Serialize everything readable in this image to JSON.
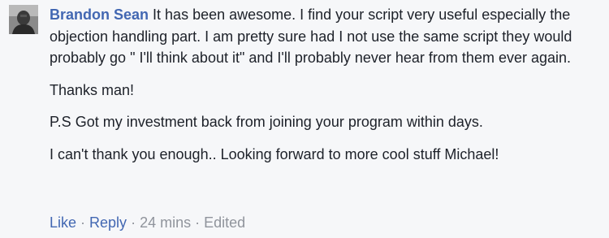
{
  "comment": {
    "author": "Brandon Sean",
    "paragraphs": [
      "It has been awesome. I find your script very useful especially the objection handling part. I am pretty sure had I not use the same script they would probably go \" I'll think about it\" and I'll probably never hear from them ever again.",
      "Thanks man!",
      "P.S Got my investment back from joining your program within days.",
      "I can't thank you enough.. Looking forward to more cool stuff Michael!"
    ],
    "actions": {
      "like": "Like",
      "reply": "Reply",
      "timestamp": "24 mins",
      "edited": "Edited",
      "separator": "·"
    }
  },
  "colors": {
    "author_link": "#4267b2",
    "meta_text": "#90949c",
    "body_text": "#1d2129",
    "background": "#f6f7f9"
  },
  "icons": {
    "avatar": "user-avatar-photo"
  }
}
